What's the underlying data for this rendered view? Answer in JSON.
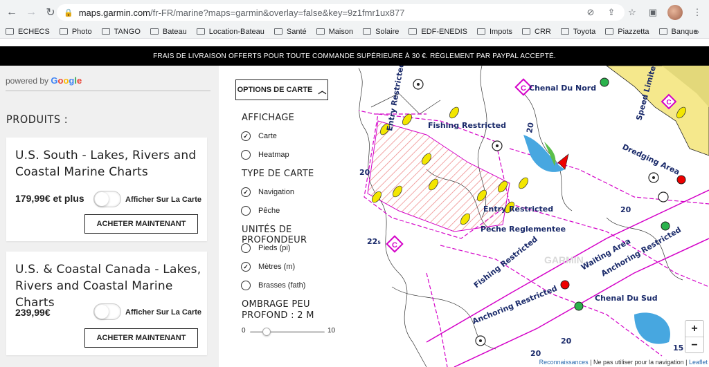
{
  "browser": {
    "url_host": "maps.garmin.com",
    "url_path": "/fr-FR/marine?maps=garmin&overlay=false&key=9z1fmr1ux877",
    "bookmarks": [
      "ECHECS",
      "Photo",
      "TANGO",
      "Bateau",
      "Location-Bateau",
      "Santé",
      "Maison",
      "Solaire",
      "EDF-ENEDIS",
      "Impots",
      "CRR",
      "Toyota",
      "Piazzetta",
      "Banque"
    ],
    "more_label": "»"
  },
  "promo": {
    "text": "FRAIS DE LIVRAISON OFFERTS POUR TOUTE COMMANDE SUPÉRIEURE À 30 €. RÈGLEMENT PAR PAYPAL ACCEPTÉ."
  },
  "sidebar": {
    "powered_by": "powered by",
    "google_label": "Google",
    "products_heading": "PRODUITS :",
    "products": [
      {
        "title": "U.S. South - Lakes, Rivers and Coastal Marine Charts",
        "price": "179,99€ et plus",
        "toggle_label": "Afficher Sur La Carte",
        "button_label": "ACHETER MAINTENANT"
      },
      {
        "title": "U.S. & Coastal Canada - Lakes, Rivers and Coastal Marine Charts",
        "price": "239,99€",
        "toggle_label": "Afficher Sur La Carte",
        "button_label": "ACHETER MAINTENANT"
      }
    ]
  },
  "options": {
    "button_label": "OPTIONS DE CARTE",
    "display_heading": "AFFICHAGE",
    "display_items": [
      {
        "label": "Carte",
        "checked": true
      },
      {
        "label": "Heatmap",
        "checked": false
      }
    ],
    "map_type_heading": "TYPE DE CARTE",
    "map_type_items": [
      {
        "label": "Navigation",
        "checked": true
      },
      {
        "label": "Pêche",
        "checked": false
      }
    ],
    "depth_units_heading": "UNITÉS DE PROFONDEUR",
    "depth_units_items": [
      {
        "label": "Pieds (pi)",
        "checked": false
      },
      {
        "label": "Mètres (m)",
        "checked": true
      },
      {
        "label": "Brasses (fath)",
        "checked": false
      }
    ],
    "shallow_shading_heading": "OMBRAGE PEU PROFOND : 2 M",
    "slider_min": "0",
    "slider_max": "10",
    "slider_value": 2
  },
  "map": {
    "labels": {
      "chenal_du_nord": "Chenal Du Nord",
      "chenal_du_sud": "Chenal Du Sud",
      "entry_restricted_1": "Entry Restricted",
      "entry_restricted_2": "Entry Restricted",
      "fishing_restricted_1": "Fishing Restricted",
      "fishing_restricted_2": "Fishing Restricted",
      "peche_reglementee": "Peche Reglementee",
      "dredging_area": "Dredging Area",
      "waiting_area": "Waiting Area",
      "anchoring_restricted_1": "Anchoring Restricted",
      "anchoring_restricted_2": "Anchoring Restricted",
      "speed_limited": "Speed Limited",
      "depth_20a": "20",
      "depth_20b": "20",
      "depth_20c": "20",
      "depth_20d": "20",
      "depth_20e": "20",
      "depth_22": "22₅",
      "depth_15": "15",
      "watermark": "GARMIN."
    },
    "zoom_in": "+",
    "zoom_out": "−",
    "attribution": {
      "recognitions": "Reconnaissances",
      "disclaimer": "| Ne pas utiliser pour la navigation |",
      "leaflet": "Leaflet"
    }
  }
}
